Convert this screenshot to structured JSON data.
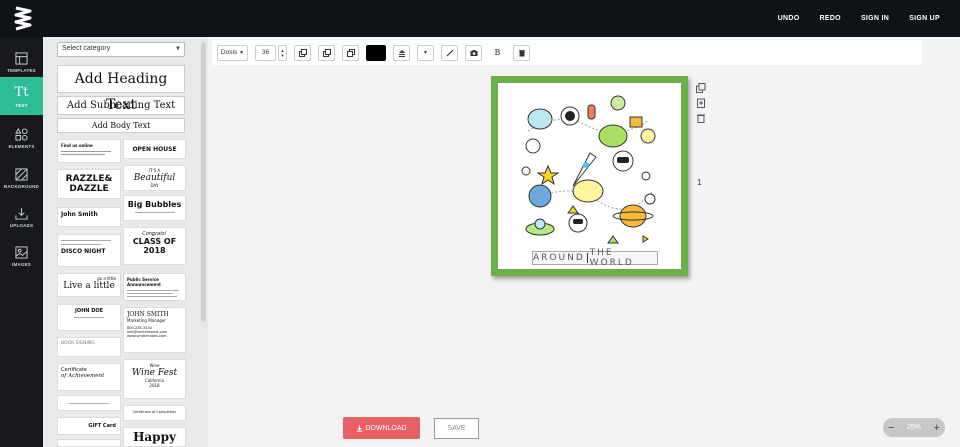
{
  "topnav": {
    "undo": "UNDO",
    "redo": "REDO",
    "sign_in": "SIGN IN",
    "sign_up": "SIGN UP"
  },
  "rail": [
    {
      "label": "TEMPLATES",
      "icon": "templates-icon"
    },
    {
      "label": "TEXT",
      "icon": "text-icon",
      "glyph": "Tt"
    },
    {
      "label": "ELEMENTS",
      "icon": "elements-icon"
    },
    {
      "label": "BACKGROUND",
      "icon": "background-icon"
    },
    {
      "label": "UPLOADS",
      "icon": "upload-icon"
    },
    {
      "label": "IMAGES",
      "icon": "image-icon"
    }
  ],
  "panel": {
    "category_placeholder": "Select category",
    "heading": "Add Heading Text",
    "subheading": "Add Subheading Text",
    "body": "Add Body Text",
    "tiles": {
      "find_us_online": "Find us online",
      "open_house": "OPEN HOUSE",
      "razzle": "RAZZLE&",
      "dazzle": "DAZZLE",
      "its_a": "IT'S A",
      "beautiful": "Beautiful",
      "day": "DAY",
      "john_smith": "John Smith",
      "big_bubbles": "Big Bubbles",
      "disco_night": "DISCO NIGHT",
      "congrats": "Congrats!",
      "class_of": "CLASS OF",
      "class_year": "2018",
      "live_a_little": "Live a little",
      "go_a_little": "go a little",
      "psa": "Public Service Announcement",
      "john_doe": "JOHN DOE",
      "john_smith_caps": "JOHN SMITH",
      "marketing_manager": "Marketing Manager",
      "phone": "800-238-3434",
      "email": "info@smithmoons.com",
      "web": "www.smithmoons.com",
      "book_signing": "BOOK SIGNING",
      "certificate": "Certificate",
      "of_achievement": "of Achievement",
      "wine": "Wine",
      "wine_fest": "Wine Fest",
      "california": "California",
      "wine_year": "2018",
      "certificate_completion": "Certificate of Completion",
      "gift_card": "GIFT Card",
      "happy": "Happy"
    }
  },
  "toolbar": {
    "font": "Dosis",
    "size": "36",
    "bold": "B"
  },
  "canvas": {
    "caption_left": "AROUND",
    "caption_right": "THE WORLD",
    "page_number": "1"
  },
  "actions": {
    "download": "DOWNLOAD",
    "save": "SAVE"
  },
  "zoom": {
    "minus": "−",
    "value": "25%",
    "plus": "+"
  },
  "colors": {
    "accent": "#2bbd95",
    "frame": "#6cb048",
    "download": "#e75e63"
  }
}
